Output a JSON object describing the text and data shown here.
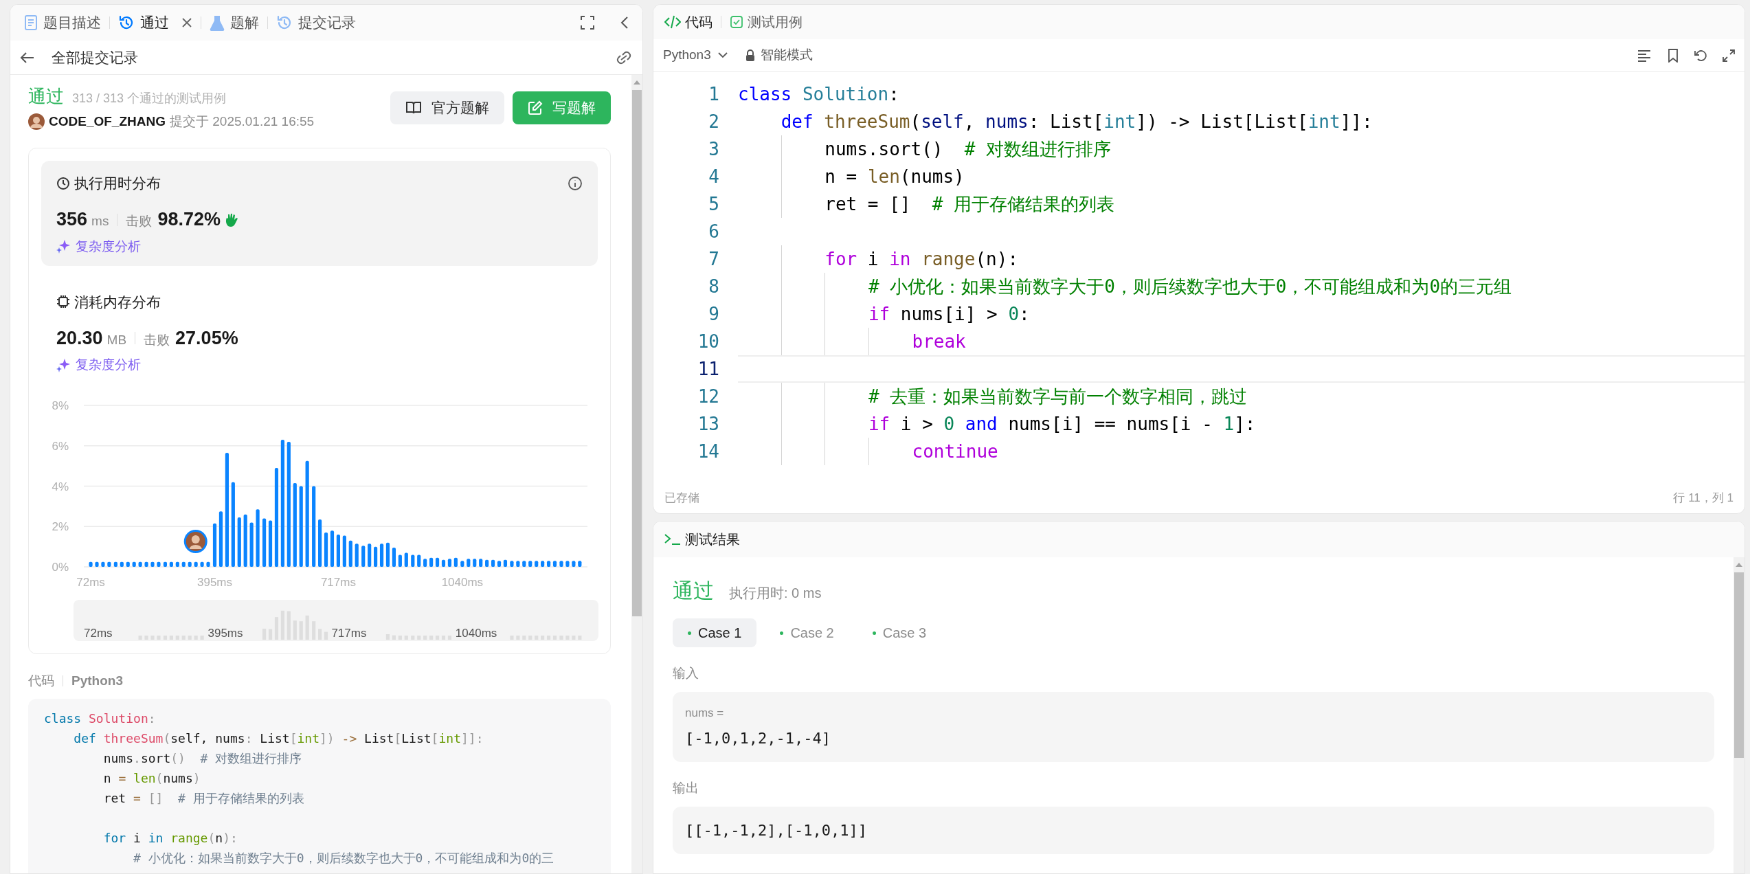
{
  "left_tabs": [
    {
      "label": "题目描述",
      "kind": "doc",
      "selected": false,
      "closable": false
    },
    {
      "label": "通过",
      "kind": "history",
      "selected": true,
      "closable": true
    },
    {
      "label": "题解",
      "kind": "flask",
      "selected": false,
      "closable": false
    },
    {
      "label": "提交记录",
      "kind": "history",
      "selected": false,
      "closable": false
    }
  ],
  "back_link": "全部提交记录",
  "submission": {
    "status": "通过",
    "tests": "313 / 313 个通过的测试用例",
    "user": "CODE_OF_ZHANG",
    "submitted": "提交于 2025.01.21 16:55",
    "buttons": [
      {
        "label": "官方题解",
        "kind": "secondary"
      },
      {
        "label": "写题解",
        "kind": "primary"
      }
    ]
  },
  "stats": [
    {
      "kind": "clock",
      "title": "执行用时分布",
      "value": "356",
      "unit": "ms",
      "beats_label": "击败",
      "beats": "98.72%",
      "link": "复杂度分析",
      "selected": true
    },
    {
      "kind": "chip",
      "title": "消耗内存分布",
      "value": "20.30",
      "unit": "MB",
      "beats_label": "击败",
      "beats": "27.05%",
      "link": "复杂度分析",
      "selected": false
    }
  ],
  "chart_data": {
    "type": "bar",
    "grid": true,
    "xlim": [
      54,
      1366
    ],
    "ylim": [
      0,
      8
    ],
    "yticks": [
      {
        "value": 0,
        "label": "0%"
      },
      {
        "value": 2,
        "label": "2%"
      },
      {
        "value": 4,
        "label": "4%"
      },
      {
        "value": 6,
        "label": "6%"
      },
      {
        "value": 8,
        "label": "8%"
      }
    ],
    "xticks": [
      {
        "value": 72,
        "label": "72ms"
      },
      {
        "value": 395,
        "label": "395ms"
      },
      {
        "value": 717,
        "label": "717ms"
      },
      {
        "value": 1040,
        "label": "1040ms"
      }
    ],
    "x": [
      72,
      88,
      104,
      120,
      137,
      153,
      169,
      185,
      201,
      217,
      233,
      249,
      266,
      282,
      298,
      314,
      330,
      346,
      362,
      378,
      395,
      411,
      427,
      443,
      459,
      475,
      491,
      507,
      524,
      540,
      556,
      572,
      588,
      604,
      620,
      636,
      653,
      669,
      685,
      701,
      717,
      733,
      749,
      765,
      782,
      798,
      814,
      830,
      846,
      862,
      878,
      894,
      911,
      927,
      943,
      959,
      975,
      991,
      1007,
      1023,
      1040,
      1056,
      1072,
      1088,
      1104,
      1120,
      1136,
      1152,
      1169,
      1185,
      1201,
      1217,
      1233,
      1249,
      1265,
      1281,
      1298,
      1314,
      1330,
      1346
    ],
    "values": [
      0.25,
      0.25,
      0.25,
      0.25,
      0.25,
      0.25,
      0.25,
      0.25,
      0.25,
      0.25,
      0.25,
      0.25,
      0.25,
      0.25,
      0.25,
      0.25,
      0.25,
      0.25,
      0.25,
      0.25,
      2.15,
      2.75,
      5.65,
      4.2,
      2.45,
      2.6,
      2.2,
      2.85,
      2.4,
      2.3,
      4.9,
      6.3,
      6.2,
      4.15,
      4.0,
      5.25,
      4.0,
      2.35,
      1.7,
      1.8,
      1.6,
      1.55,
      1.3,
      1.15,
      1.05,
      1.15,
      1.0,
      1.15,
      1.2,
      0.95,
      0.6,
      0.7,
      0.6,
      0.6,
      0.4,
      0.45,
      0.45,
      0.35,
      0.4,
      0.45,
      0.3,
      0.4,
      0.4,
      0.4,
      0.35,
      0.35,
      0.3,
      0.35,
      0.3,
      0.3,
      0.3,
      0.3,
      0.3,
      0.3,
      0.3,
      0.3,
      0.3,
      0.3,
      0.3,
      0.3
    ]
  },
  "overview_labels": [
    "72ms",
    "395ms",
    "717ms",
    "1040ms"
  ],
  "code_section": {
    "label": "代码",
    "language": "Python3",
    "lines": [
      {
        "kind": "code",
        "spans": [
          {
            "text": "class",
            "kind": "kw"
          },
          {
            "text": " Solution",
            "kind": "title"
          },
          {
            "text": ":",
            "kind": "punct"
          }
        ]
      },
      {
        "kind": "code",
        "spans": [
          {
            "text": "    def",
            "kind": "kw"
          },
          {
            "text": " threeSum",
            "kind": "title"
          },
          {
            "text": "(",
            "kind": "punct"
          },
          {
            "text": "self, nums",
            "kind": "plain"
          },
          {
            "text": ":",
            "kind": "punct"
          },
          {
            "text": " List",
            "kind": "plain"
          },
          {
            "text": "[",
            "kind": "punct"
          },
          {
            "text": "int",
            "kind": "builtin"
          },
          {
            "text": "])",
            "kind": "punct"
          },
          {
            "text": " ->",
            "kind": "op"
          },
          {
            "text": " List",
            "kind": "plain"
          },
          {
            "text": "[",
            "kind": "punct"
          },
          {
            "text": "List",
            "kind": "plain"
          },
          {
            "text": "[",
            "kind": "punct"
          },
          {
            "text": "int",
            "kind": "builtin"
          },
          {
            "text": "]]:",
            "kind": "punct"
          }
        ]
      },
      {
        "kind": "code",
        "spans": [
          {
            "text": "        nums",
            "kind": "plain"
          },
          {
            "text": ".",
            "kind": "punct"
          },
          {
            "text": "sort",
            "kind": "plain"
          },
          {
            "text": "()",
            "kind": "punct"
          },
          {
            "text": "  # 对数组进行排序",
            "kind": "cm"
          }
        ]
      },
      {
        "kind": "code",
        "spans": [
          {
            "text": "        n",
            "kind": "plain"
          },
          {
            "text": " =",
            "kind": "op"
          },
          {
            "text": " len",
            "kind": "builtin"
          },
          {
            "text": "(",
            "kind": "punct"
          },
          {
            "text": "nums",
            "kind": "plain"
          },
          {
            "text": ")",
            "kind": "punct"
          }
        ]
      },
      {
        "kind": "code",
        "spans": [
          {
            "text": "        ret",
            "kind": "plain"
          },
          {
            "text": " =",
            "kind": "op"
          },
          {
            "text": " []",
            "kind": "punct"
          },
          {
            "text": "  # 用于存储结果的列表",
            "kind": "cm"
          }
        ]
      },
      {
        "kind": "blank"
      },
      {
        "kind": "code",
        "spans": [
          {
            "text": "        for",
            "kind": "kw"
          },
          {
            "text": " i",
            "kind": "plain"
          },
          {
            "text": " in",
            "kind": "kw"
          },
          {
            "text": " range",
            "kind": "builtin"
          },
          {
            "text": "(",
            "kind": "punct"
          },
          {
            "text": "n",
            "kind": "plain"
          },
          {
            "text": "):",
            "kind": "punct"
          }
        ]
      },
      {
        "kind": "code",
        "spans": [
          {
            "text": "            # 小优化：如果当前数字大于0，则后续数字也大于0，不可能组成和为0的三",
            "kind": "cm"
          }
        ]
      }
    ]
  },
  "editor_tabs": [
    {
      "label": "代码",
      "kind": "code",
      "selected": true
    },
    {
      "label": "测试用例",
      "kind": "check",
      "selected": false
    }
  ],
  "editor_toolbar": {
    "language": "Python3",
    "mode": "智能模式"
  },
  "editor_lines": [
    {
      "n": "1",
      "current": false,
      "kind": "code",
      "spans": [
        {
          "text": "class",
          "kind": "kw"
        },
        {
          "text": " Solution",
          "kind": "cls"
        },
        {
          "text": ":",
          "kind": "plain"
        }
      ]
    },
    {
      "n": "2",
      "current": false,
      "kind": "code",
      "spans": [
        {
          "text": "    def",
          "kind": "kw"
        },
        {
          "text": " threeSum",
          "kind": "fn"
        },
        {
          "text": "(",
          "kind": "plain"
        },
        {
          "text": "self",
          "kind": "var"
        },
        {
          "text": ", ",
          "kind": "plain"
        },
        {
          "text": "nums",
          "kind": "var"
        },
        {
          "text": ": List[",
          "kind": "plain"
        },
        {
          "text": "int",
          "kind": "cls"
        },
        {
          "text": "]) -> List[List[",
          "kind": "plain"
        },
        {
          "text": "int",
          "kind": "cls"
        },
        {
          "text": "]]:",
          "kind": "plain"
        }
      ]
    },
    {
      "n": "3",
      "current": false,
      "kind": "code",
      "spans": [
        {
          "text": "        nums.sort()  ",
          "kind": "plain"
        },
        {
          "text": "# 对数组进行排序",
          "kind": "cm"
        }
      ]
    },
    {
      "n": "4",
      "current": false,
      "kind": "code",
      "spans": [
        {
          "text": "        n = ",
          "kind": "plain"
        },
        {
          "text": "len",
          "kind": "fn"
        },
        {
          "text": "(nums)",
          "kind": "plain"
        }
      ]
    },
    {
      "n": "5",
      "current": false,
      "kind": "code",
      "spans": [
        {
          "text": "        ret = []  ",
          "kind": "plain"
        },
        {
          "text": "# 用于存储结果的列表",
          "kind": "cm"
        }
      ]
    },
    {
      "n": "6",
      "current": false,
      "kind": "blank"
    },
    {
      "n": "7",
      "current": false,
      "kind": "code",
      "spans": [
        {
          "text": "        for",
          "kind": "ctl"
        },
        {
          "text": " i ",
          "kind": "plain"
        },
        {
          "text": "in",
          "kind": "ctl"
        },
        {
          "text": " range",
          "kind": "fn"
        },
        {
          "text": "(n):",
          "kind": "plain"
        }
      ]
    },
    {
      "n": "8",
      "current": false,
      "kind": "code",
      "spans": [
        {
          "text": "            # 小优化：如果当前数字大于0，则后续数字也大于0，不可能组成和为0的三元组",
          "kind": "cm"
        }
      ]
    },
    {
      "n": "9",
      "current": false,
      "kind": "code",
      "spans": [
        {
          "text": "            if",
          "kind": "ctl"
        },
        {
          "text": " nums[i] > ",
          "kind": "plain"
        },
        {
          "text": "0",
          "kind": "num"
        },
        {
          "text": ":",
          "kind": "plain"
        }
      ]
    },
    {
      "n": "10",
      "current": false,
      "kind": "code",
      "spans": [
        {
          "text": "                break",
          "kind": "ctl"
        }
      ]
    },
    {
      "n": "11",
      "current": true,
      "kind": "blank"
    },
    {
      "n": "12",
      "current": false,
      "kind": "code",
      "spans": [
        {
          "text": "            # 去重：如果当前数字与前一个数字相同，跳过",
          "kind": "cm"
        }
      ]
    },
    {
      "n": "13",
      "current": false,
      "kind": "code",
      "spans": [
        {
          "text": "            if",
          "kind": "ctl"
        },
        {
          "text": " i > ",
          "kind": "plain"
        },
        {
          "text": "0",
          "kind": "num"
        },
        {
          "text": " and",
          "kind": "kw"
        },
        {
          "text": " nums[i] == nums[i - ",
          "kind": "plain"
        },
        {
          "text": "1",
          "kind": "num"
        },
        {
          "text": "]:",
          "kind": "plain"
        }
      ]
    },
    {
      "n": "14",
      "current": false,
      "kind": "code",
      "spans": [
        {
          "text": "                continue",
          "kind": "ctl"
        }
      ]
    }
  ],
  "editor_status": {
    "saved": "已存储",
    "cursor": "行 11，列 1"
  },
  "results": {
    "title": "测试结果",
    "status": "通过",
    "runtime": "执行用时: 0 ms",
    "cases": [
      {
        "label": "Case 1",
        "selected": true,
        "color": "#2db55d"
      },
      {
        "label": "Case 2",
        "selected": false,
        "color": "#2db55d"
      },
      {
        "label": "Case 3",
        "selected": false,
        "color": "#2db55d"
      }
    ],
    "input_label": "输入",
    "input_name": "nums =",
    "input_value": "[-1,0,1,2,-1,-4]",
    "output_label": "输出",
    "output_value": "[[-1,-1,2],[-1,0,1]]"
  }
}
